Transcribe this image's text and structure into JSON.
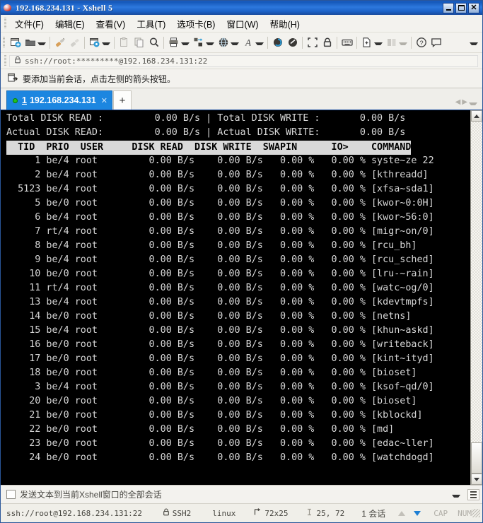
{
  "window": {
    "title": "192.168.234.131 - Xshell 5",
    "icon": "xshell-logo-icon",
    "minimize_label": "",
    "maximize_label": "",
    "close_label": "✕"
  },
  "menu": {
    "items": [
      {
        "label": "文件(F)",
        "name": "menu-file"
      },
      {
        "label": "编辑(E)",
        "name": "menu-edit"
      },
      {
        "label": "查看(V)",
        "name": "menu-view"
      },
      {
        "label": "工具(T)",
        "name": "menu-tools"
      },
      {
        "label": "选项卡(B)",
        "name": "menu-tab"
      },
      {
        "label": "窗口(W)",
        "name": "menu-window"
      },
      {
        "label": "帮助(H)",
        "name": "menu-help"
      }
    ]
  },
  "toolbar": {
    "buttons": [
      {
        "name": "new-session-icon",
        "glyph": "new"
      },
      {
        "name": "open-session-icon",
        "glyph": "folder"
      },
      {
        "name": "sep1",
        "glyph": "sep"
      },
      {
        "name": "connect-icon",
        "glyph": "plug"
      },
      {
        "name": "disconnect-icon",
        "glyph": "plug-off"
      },
      {
        "name": "sep2",
        "glyph": "sep"
      },
      {
        "name": "properties-icon",
        "glyph": "props"
      },
      {
        "name": "sep3",
        "glyph": "sep"
      },
      {
        "name": "paste-icon",
        "glyph": "paste"
      },
      {
        "name": "copy-icon",
        "glyph": "copy"
      },
      {
        "name": "find-icon",
        "glyph": "search"
      },
      {
        "name": "sep4",
        "glyph": "sep"
      },
      {
        "name": "print-icon",
        "glyph": "print"
      },
      {
        "name": "transfer-icon",
        "glyph": "transfer"
      },
      {
        "name": "browser-icon",
        "glyph": "globe"
      },
      {
        "name": "sep5",
        "glyph": "sep"
      },
      {
        "name": "font-icon",
        "glyph": "font"
      },
      {
        "name": "sep6",
        "glyph": "sep"
      },
      {
        "name": "session-manager-icon",
        "glyph": "swirl1"
      },
      {
        "name": "compose-icon",
        "glyph": "swirl2"
      },
      {
        "name": "sep7",
        "glyph": "sep"
      },
      {
        "name": "fullscreen-icon",
        "glyph": "expand"
      },
      {
        "name": "lock-icon",
        "glyph": "lock"
      },
      {
        "name": "sep8",
        "glyph": "sep"
      },
      {
        "name": "keyboard-icon",
        "glyph": "keyboard"
      },
      {
        "name": "sep9",
        "glyph": "sep"
      },
      {
        "name": "new-file-icon",
        "glyph": "newfile"
      },
      {
        "name": "layout-icon",
        "glyph": "layout"
      },
      {
        "name": "sep10",
        "glyph": "sep"
      },
      {
        "name": "help-icon",
        "glyph": "help"
      },
      {
        "name": "feedback-icon",
        "glyph": "chat"
      }
    ],
    "overflow_label": ""
  },
  "address_bar": {
    "lock_icon": "lock-icon",
    "value": "ssh://root:*********@192.168.234.131:22"
  },
  "notice": {
    "icon": "add-session-icon",
    "text": "要添加当前会话，点击左侧的箭头按钮。"
  },
  "tabs": {
    "items": [
      {
        "index": "1",
        "label": "192.168.234.131",
        "close": "✕",
        "status": "connected"
      }
    ],
    "new_tab_label": "+",
    "nav_prev": "◀",
    "nav_sep": "◀▶",
    "nav_next": "▶"
  },
  "terminal": {
    "summary": [
      {
        "left_label": "Total DISK READ :",
        "left_value": "0.00 B/s",
        "right_label": "Total DISK WRITE :",
        "right_value": "0.00 B/s"
      },
      {
        "left_label": "Actual DISK READ:",
        "left_value": "0.00 B/s",
        "right_label": "Actual DISK WRITE:",
        "right_value": "0.00 B/s"
      }
    ],
    "header_line": "  TID  PRIO  USER     DISK READ  DISK WRITE  SWAPIN      IO>    COMMAND",
    "columns": [
      "TID",
      "PRIO",
      "USER",
      "DISK READ",
      "DISK WRITE",
      "SWAPIN",
      "IO>",
      "COMMAND"
    ],
    "sort_column": "IO>",
    "rows": [
      {
        "tid": "1",
        "prio": "be/4",
        "user": "root",
        "disk_read": "0.00 B/s",
        "disk_write": "0.00 B/s",
        "swapin": "0.00 %",
        "io": "0.00 %",
        "command": "syste~ze 22"
      },
      {
        "tid": "2",
        "prio": "be/4",
        "user": "root",
        "disk_read": "0.00 B/s",
        "disk_write": "0.00 B/s",
        "swapin": "0.00 %",
        "io": "0.00 %",
        "command": "[kthreadd]"
      },
      {
        "tid": "5123",
        "prio": "be/4",
        "user": "root",
        "disk_read": "0.00 B/s",
        "disk_write": "0.00 B/s",
        "swapin": "0.00 %",
        "io": "0.00 %",
        "command": "[xfsa~sda1]"
      },
      {
        "tid": "5",
        "prio": "be/0",
        "user": "root",
        "disk_read": "0.00 B/s",
        "disk_write": "0.00 B/s",
        "swapin": "0.00 %",
        "io": "0.00 %",
        "command": "[kwor~0:0H]"
      },
      {
        "tid": "6",
        "prio": "be/4",
        "user": "root",
        "disk_read": "0.00 B/s",
        "disk_write": "0.00 B/s",
        "swapin": "0.00 %",
        "io": "0.00 %",
        "command": "[kwor~56:0]"
      },
      {
        "tid": "7",
        "prio": "rt/4",
        "user": "root",
        "disk_read": "0.00 B/s",
        "disk_write": "0.00 B/s",
        "swapin": "0.00 %",
        "io": "0.00 %",
        "command": "[migr~on/0]"
      },
      {
        "tid": "8",
        "prio": "be/4",
        "user": "root",
        "disk_read": "0.00 B/s",
        "disk_write": "0.00 B/s",
        "swapin": "0.00 %",
        "io": "0.00 %",
        "command": "[rcu_bh]"
      },
      {
        "tid": "9",
        "prio": "be/4",
        "user": "root",
        "disk_read": "0.00 B/s",
        "disk_write": "0.00 B/s",
        "swapin": "0.00 %",
        "io": "0.00 %",
        "command": "[rcu_sched]"
      },
      {
        "tid": "10",
        "prio": "be/0",
        "user": "root",
        "disk_read": "0.00 B/s",
        "disk_write": "0.00 B/s",
        "swapin": "0.00 %",
        "io": "0.00 %",
        "command": "[lru-~rain]"
      },
      {
        "tid": "11",
        "prio": "rt/4",
        "user": "root",
        "disk_read": "0.00 B/s",
        "disk_write": "0.00 B/s",
        "swapin": "0.00 %",
        "io": "0.00 %",
        "command": "[watc~og/0]"
      },
      {
        "tid": "13",
        "prio": "be/4",
        "user": "root",
        "disk_read": "0.00 B/s",
        "disk_write": "0.00 B/s",
        "swapin": "0.00 %",
        "io": "0.00 %",
        "command": "[kdevtmpfs]"
      },
      {
        "tid": "14",
        "prio": "be/0",
        "user": "root",
        "disk_read": "0.00 B/s",
        "disk_write": "0.00 B/s",
        "swapin": "0.00 %",
        "io": "0.00 %",
        "command": "[netns]"
      },
      {
        "tid": "15",
        "prio": "be/4",
        "user": "root",
        "disk_read": "0.00 B/s",
        "disk_write": "0.00 B/s",
        "swapin": "0.00 %",
        "io": "0.00 %",
        "command": "[khun~askd]"
      },
      {
        "tid": "16",
        "prio": "be/0",
        "user": "root",
        "disk_read": "0.00 B/s",
        "disk_write": "0.00 B/s",
        "swapin": "0.00 %",
        "io": "0.00 %",
        "command": "[writeback]"
      },
      {
        "tid": "17",
        "prio": "be/0",
        "user": "root",
        "disk_read": "0.00 B/s",
        "disk_write": "0.00 B/s",
        "swapin": "0.00 %",
        "io": "0.00 %",
        "command": "[kint~ityd]"
      },
      {
        "tid": "18",
        "prio": "be/0",
        "user": "root",
        "disk_read": "0.00 B/s",
        "disk_write": "0.00 B/s",
        "swapin": "0.00 %",
        "io": "0.00 %",
        "command": "[bioset]"
      },
      {
        "tid": "3",
        "prio": "be/4",
        "user": "root",
        "disk_read": "0.00 B/s",
        "disk_write": "0.00 B/s",
        "swapin": "0.00 %",
        "io": "0.00 %",
        "command": "[ksof~qd/0]"
      },
      {
        "tid": "20",
        "prio": "be/0",
        "user": "root",
        "disk_read": "0.00 B/s",
        "disk_write": "0.00 B/s",
        "swapin": "0.00 %",
        "io": "0.00 %",
        "command": "[bioset]"
      },
      {
        "tid": "21",
        "prio": "be/0",
        "user": "root",
        "disk_read": "0.00 B/s",
        "disk_write": "0.00 B/s",
        "swapin": "0.00 %",
        "io": "0.00 %",
        "command": "[kblockd]"
      },
      {
        "tid": "22",
        "prio": "be/0",
        "user": "root",
        "disk_read": "0.00 B/s",
        "disk_write": "0.00 B/s",
        "swapin": "0.00 %",
        "io": "0.00 %",
        "command": "[md]"
      },
      {
        "tid": "23",
        "prio": "be/0",
        "user": "root",
        "disk_read": "0.00 B/s",
        "disk_write": "0.00 B/s",
        "swapin": "0.00 %",
        "io": "0.00 %",
        "command": "[edac~ller]"
      },
      {
        "tid": "24",
        "prio": "be/0",
        "user": "root",
        "disk_read": "0.00 B/s",
        "disk_write": "0.00 B/s",
        "swapin": "0.00 %",
        "io": "0.00 %",
        "command": "[watchdogd]"
      }
    ]
  },
  "send_bar": {
    "checkbox_checked": false,
    "label": "发送文本到当前Xshell窗口的全部会话",
    "menu_icon": "hamburger-icon"
  },
  "status_bar": {
    "url": "ssh://root@192.168.234.131:22",
    "protocol": "SSH2",
    "protocol_icon": "lock-icon",
    "term_type": "linux",
    "size": "72x25",
    "size_icon": "resize-icon",
    "cursor": "25, 72",
    "cursor_icon": "cursor-icon",
    "sessions": "1 会话",
    "upload_icon": "arrow-up-icon",
    "download_icon": "arrow-down-icon",
    "caps": "CAP",
    "num": "NUM"
  },
  "colors": {
    "title_blue": "#1d63c8",
    "tab_blue": "#1c86e0",
    "terminal_bg": "#000000",
    "terminal_fg": "#d7d7d7",
    "header_bg": "#d9d9d9",
    "chrome_bg": "#f3f2ee",
    "status_green": "#22c322",
    "download_blue": "#1e7fd4"
  }
}
